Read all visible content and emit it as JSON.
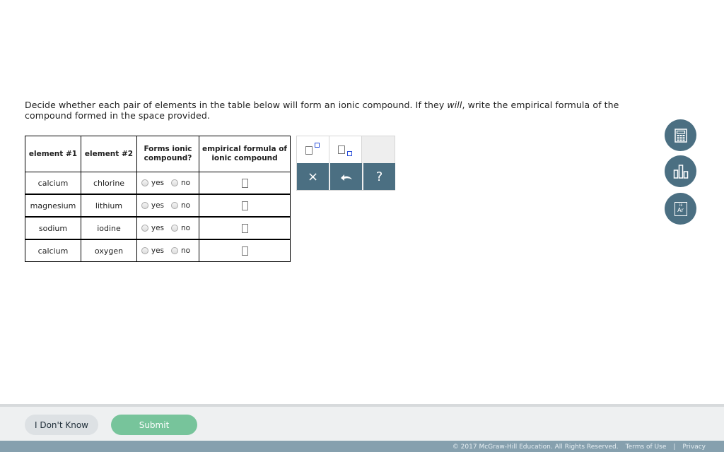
{
  "question": {
    "text_before": "Decide whether each pair of elements in the table below will form an ionic compound. If they ",
    "text_emphasis": "will",
    "text_after": ", write the empirical formula of the compound formed in the space provided."
  },
  "table": {
    "headers": {
      "element1": "element #1",
      "element2": "element #2",
      "forms_line1": "Forms ionic",
      "forms_line2": "compound?",
      "formula_line1": "empirical formula of",
      "formula_line2": "ionic compound"
    },
    "rows": [
      {
        "element1": "calcium",
        "element2": "chlorine",
        "yes": "yes",
        "no": "no"
      },
      {
        "element1": "magnesium",
        "element2": "lithium",
        "yes": "yes",
        "no": "no"
      },
      {
        "element1": "sodium",
        "element2": "iodine",
        "yes": "yes",
        "no": "no"
      },
      {
        "element1": "calcium",
        "element2": "oxygen",
        "yes": "yes",
        "no": "no"
      }
    ]
  },
  "palette": {
    "superscript_icon": "superscript-template-icon",
    "subscript_icon": "subscript-template-icon",
    "clear_label": "×",
    "undo_icon": "undo-icon",
    "help_label": "?"
  },
  "tools": {
    "calculator_icon": "calculator-icon",
    "data_icon": "bar-chart-icon",
    "periodic_table_icon": "periodic-table-icon",
    "periodic_table_number": "18",
    "periodic_table_symbol": "Ar"
  },
  "footer": {
    "dont_know_label": "I Don't Know",
    "submit_label": "Submit",
    "copyright": "© 2017 McGraw-Hill Education. All Rights Reserved.",
    "terms": "Terms of Use",
    "separator": "|",
    "privacy": "Privacy"
  },
  "colors": {
    "accent": "#4b6f82",
    "submit": "#77c49b",
    "legal_bar": "#86a0ae"
  }
}
